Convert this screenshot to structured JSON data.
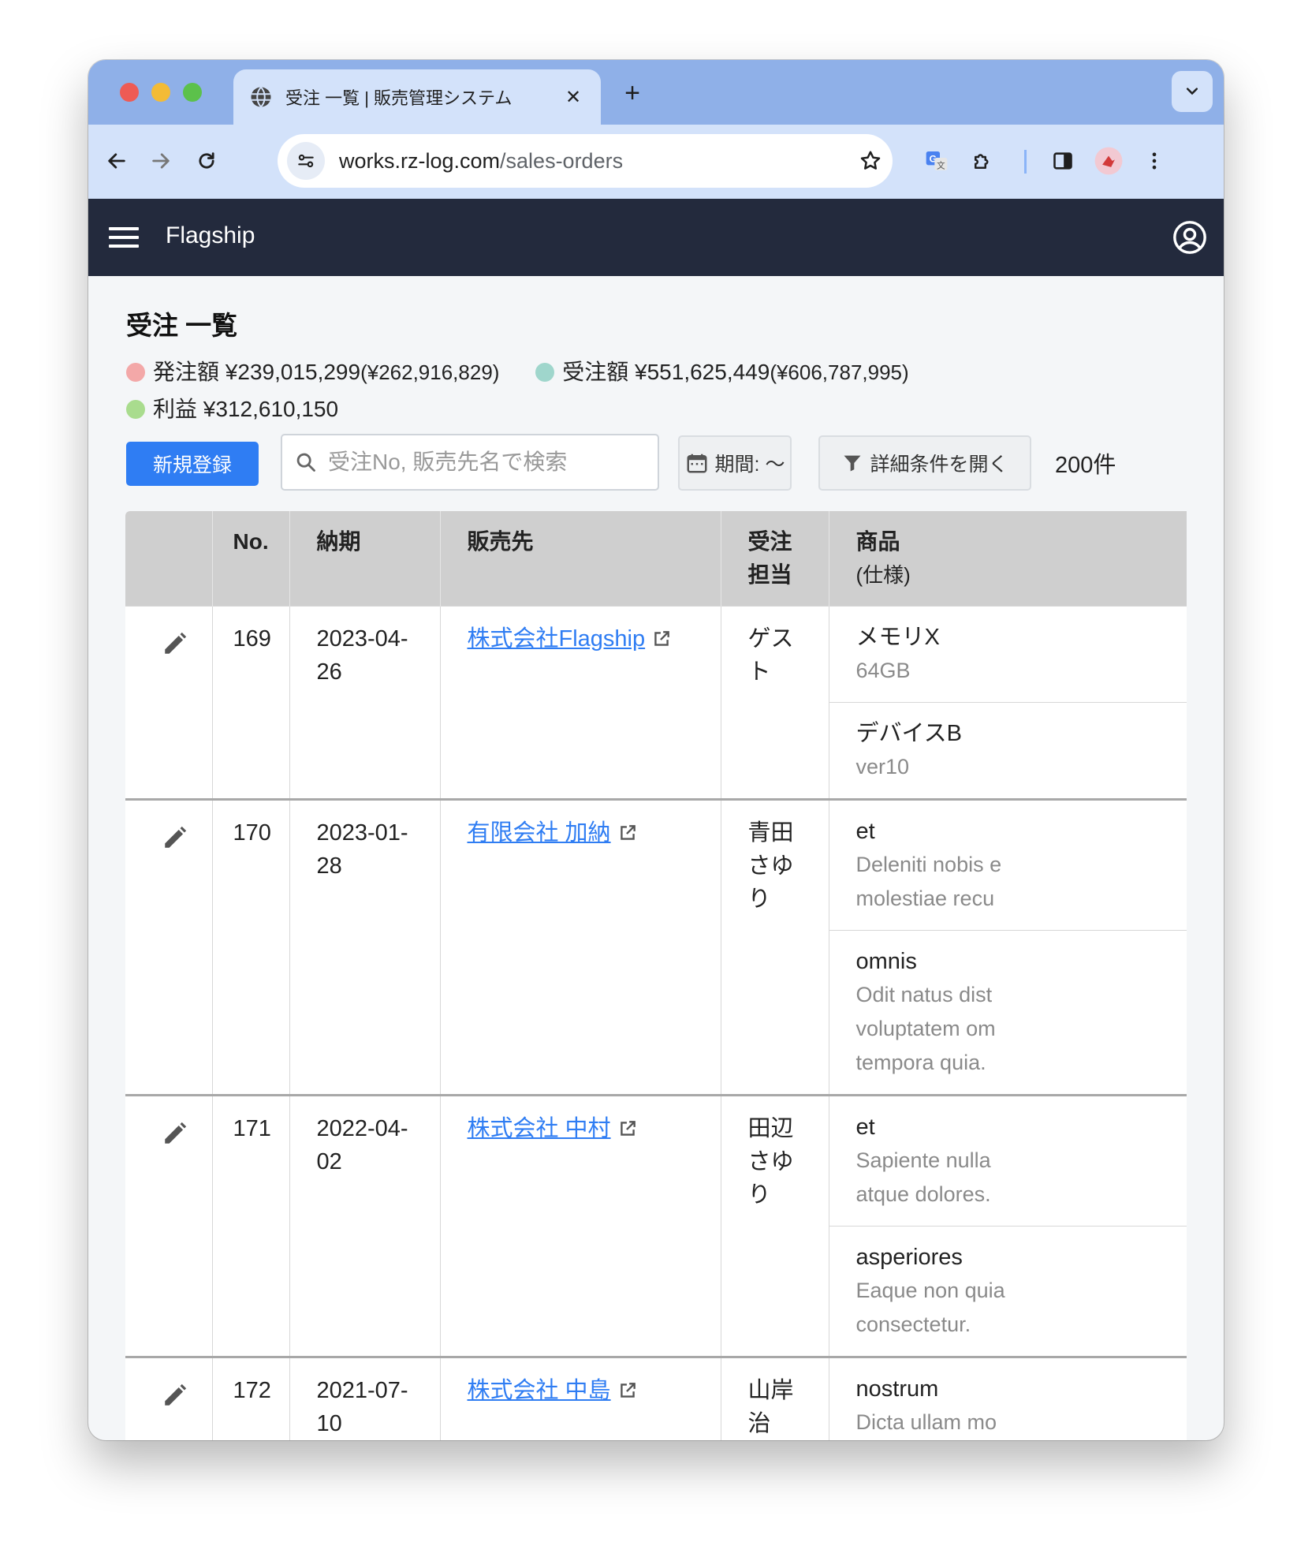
{
  "browser": {
    "tab_title": "受注 一覧 | 販売管理システム",
    "url_domain": "works.rz-log.com",
    "url_path": "/sales-orders"
  },
  "app": {
    "brand": "Flagship"
  },
  "page": {
    "title": "受注 一覧",
    "summary": {
      "order_amount_label": "発注額",
      "order_amount": "¥239,015,299",
      "order_amount_sub": "(¥262,916,829)",
      "sales_amount_label": "受注額",
      "sales_amount": "¥551,625,449",
      "sales_amount_sub": "(¥606,787,995)",
      "profit_label": "利益",
      "profit": "¥312,610,150",
      "colors": {
        "order": "#f3a8a8",
        "sales": "#9fd6cc",
        "profit": "#a9dc8e"
      }
    },
    "new_button": "新規登録",
    "search_placeholder": "受注No, 販売先名で検索",
    "period_button": "期間: 〜",
    "filter_button": "詳細条件を開く",
    "count": "200件"
  },
  "table": {
    "headers": {
      "no": "No.",
      "due": "納期",
      "customer": "販売先",
      "staff": "受注担当",
      "product": "商品",
      "product_sub": "(仕様)"
    },
    "rows": [
      {
        "no": "169",
        "due": "2023-04-26",
        "customer": "株式会社Flagship",
        "staff": "ゲスト",
        "products": [
          {
            "name": "メモリX",
            "spec": "64GB"
          },
          {
            "name": "デバイスB",
            "spec": "ver10"
          }
        ]
      },
      {
        "no": "170",
        "due": "2023-01-28",
        "customer": "有限会社 加納",
        "staff": "青田 さゆり",
        "products": [
          {
            "name": "et",
            "spec": "Deleniti nobis e",
            "spec2": "molestiae recu"
          },
          {
            "name": "omnis",
            "spec": "Odit natus dist",
            "spec2": "voluptatem om",
            "spec3": "tempora quia."
          }
        ]
      },
      {
        "no": "171",
        "due": "2022-04-02",
        "customer": "株式会社 中村",
        "staff": "田辺 さゆり",
        "products": [
          {
            "name": "et",
            "spec": "Sapiente nulla",
            "spec2": "atque dolores."
          },
          {
            "name": "asperiores",
            "spec": "Eaque non quia",
            "spec2": "consectetur."
          }
        ]
      },
      {
        "no": "172",
        "due": "2021-07-10",
        "customer": "株式会社 中島",
        "staff": "山岸 治",
        "products": [
          {
            "name": "nostrum",
            "spec": "Dicta ullam mo"
          }
        ]
      }
    ]
  }
}
